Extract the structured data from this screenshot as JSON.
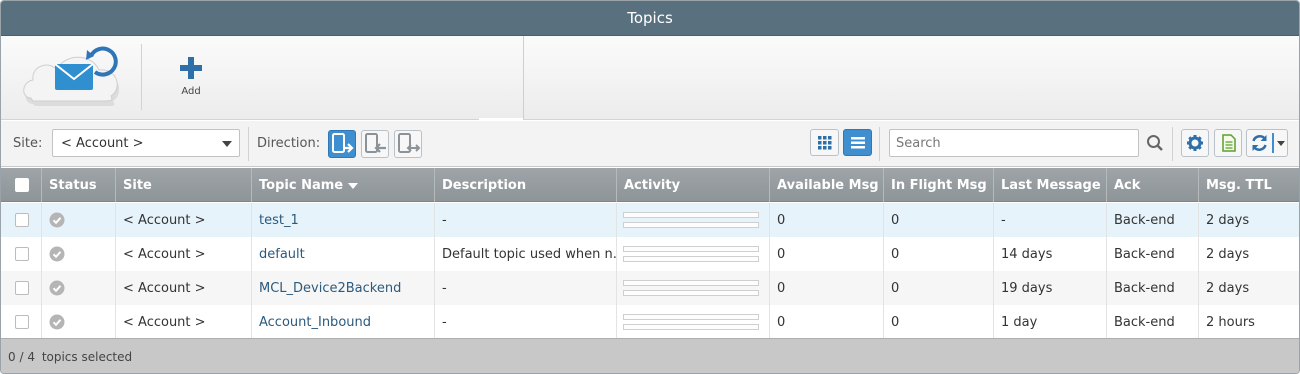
{
  "window": {
    "title": "Topics"
  },
  "toolbar": {
    "add_label": "Add"
  },
  "filters": {
    "site_label": "Site:",
    "site_value": "< Account >",
    "direction_label": "Direction:",
    "search_placeholder": "Search"
  },
  "table": {
    "columns": [
      "Status",
      "Site",
      "Topic Name",
      "Description",
      "Activity",
      "Available Msg",
      "In Flight Msg",
      "Last Message",
      "Ack",
      "Msg. TTL"
    ],
    "sorted_column": "Topic Name",
    "rows": [
      {
        "site": "< Account >",
        "topic": "test_1",
        "description": "-",
        "available": "0",
        "inflight": "0",
        "last": "-",
        "ack": "Back-end",
        "ttl": "2 days"
      },
      {
        "site": "< Account >",
        "topic": "default",
        "description": "Default topic used when n...",
        "available": "0",
        "inflight": "0",
        "last": "14 days",
        "ack": "Back-end",
        "ttl": "2 days"
      },
      {
        "site": "< Account >",
        "topic": "MCL_Device2Backend",
        "description": "-",
        "available": "0",
        "inflight": "0",
        "last": "19 days",
        "ack": "Back-end",
        "ttl": "2 days"
      },
      {
        "site": "< Account >",
        "topic": "Account_Inbound",
        "description": "-",
        "available": "0",
        "inflight": "0",
        "last": "1 day",
        "ack": "Back-end",
        "ttl": "2 hours"
      }
    ]
  },
  "footer": {
    "selected_count": "0",
    "separator": "/",
    "total": "4",
    "suffix": "topics selected"
  },
  "colors": {
    "title_bar": "#59707f",
    "header": "#959c a0",
    "accent": "#3f8fd0",
    "link": "#2c5a7d"
  },
  "icons": [
    "cloud-mail-icon",
    "sync-icon",
    "plus-icon",
    "direction-inbound-icon",
    "direction-outbound-icon",
    "direction-both-icon",
    "grid-view-icon",
    "list-view-icon",
    "search-icon",
    "gear-icon",
    "export-icon",
    "refresh-icon",
    "status-check-icon"
  ]
}
